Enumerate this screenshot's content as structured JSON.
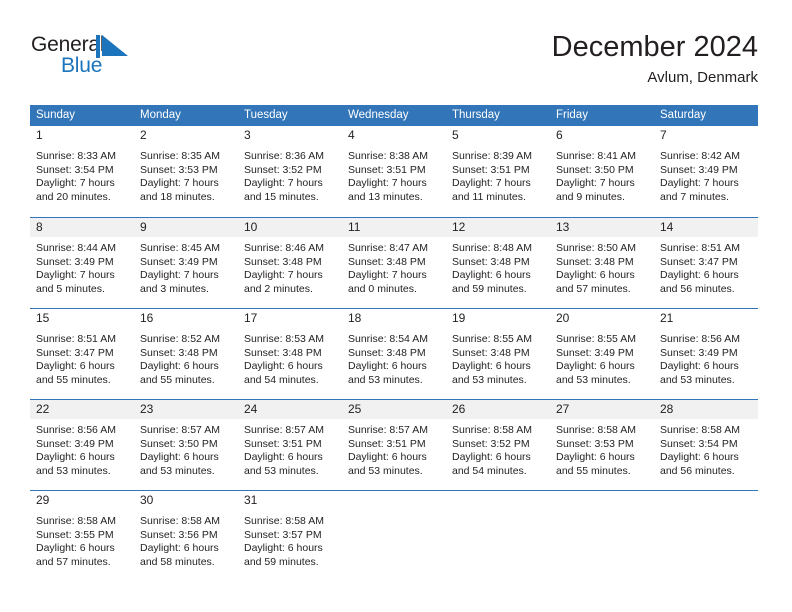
{
  "brand": {
    "name_part1": "General",
    "name_part2": "Blue",
    "mark_icon": "blue-flag-triangle-icon"
  },
  "header": {
    "title": "December 2024",
    "subtitle": "Avlum, Denmark"
  },
  "colors": {
    "header_blue": "#3275B8",
    "brand_blue": "#1C75BC",
    "row_shade": "#F1F1F1",
    "text": "#231F20"
  },
  "weekdays": [
    "Sunday",
    "Monday",
    "Tuesday",
    "Wednesday",
    "Thursday",
    "Friday",
    "Saturday"
  ],
  "weeks": [
    {
      "shaded": false,
      "days": [
        {
          "num": "1",
          "sunrise": "Sunrise: 8:33 AM",
          "sunset": "Sunset: 3:54 PM",
          "daylight1": "Daylight: 7 hours",
          "daylight2": "and 20 minutes."
        },
        {
          "num": "2",
          "sunrise": "Sunrise: 8:35 AM",
          "sunset": "Sunset: 3:53 PM",
          "daylight1": "Daylight: 7 hours",
          "daylight2": "and 18 minutes."
        },
        {
          "num": "3",
          "sunrise": "Sunrise: 8:36 AM",
          "sunset": "Sunset: 3:52 PM",
          "daylight1": "Daylight: 7 hours",
          "daylight2": "and 15 minutes."
        },
        {
          "num": "4",
          "sunrise": "Sunrise: 8:38 AM",
          "sunset": "Sunset: 3:51 PM",
          "daylight1": "Daylight: 7 hours",
          "daylight2": "and 13 minutes."
        },
        {
          "num": "5",
          "sunrise": "Sunrise: 8:39 AM",
          "sunset": "Sunset: 3:51 PM",
          "daylight1": "Daylight: 7 hours",
          "daylight2": "and 11 minutes."
        },
        {
          "num": "6",
          "sunrise": "Sunrise: 8:41 AM",
          "sunset": "Sunset: 3:50 PM",
          "daylight1": "Daylight: 7 hours",
          "daylight2": "and 9 minutes."
        },
        {
          "num": "7",
          "sunrise": "Sunrise: 8:42 AM",
          "sunset": "Sunset: 3:49 PM",
          "daylight1": "Daylight: 7 hours",
          "daylight2": "and 7 minutes."
        }
      ]
    },
    {
      "shaded": true,
      "days": [
        {
          "num": "8",
          "sunrise": "Sunrise: 8:44 AM",
          "sunset": "Sunset: 3:49 PM",
          "daylight1": "Daylight: 7 hours",
          "daylight2": "and 5 minutes."
        },
        {
          "num": "9",
          "sunrise": "Sunrise: 8:45 AM",
          "sunset": "Sunset: 3:49 PM",
          "daylight1": "Daylight: 7 hours",
          "daylight2": "and 3 minutes."
        },
        {
          "num": "10",
          "sunrise": "Sunrise: 8:46 AM",
          "sunset": "Sunset: 3:48 PM",
          "daylight1": "Daylight: 7 hours",
          "daylight2": "and 2 minutes."
        },
        {
          "num": "11",
          "sunrise": "Sunrise: 8:47 AM",
          "sunset": "Sunset: 3:48 PM",
          "daylight1": "Daylight: 7 hours",
          "daylight2": "and 0 minutes."
        },
        {
          "num": "12",
          "sunrise": "Sunrise: 8:48 AM",
          "sunset": "Sunset: 3:48 PM",
          "daylight1": "Daylight: 6 hours",
          "daylight2": "and 59 minutes."
        },
        {
          "num": "13",
          "sunrise": "Sunrise: 8:50 AM",
          "sunset": "Sunset: 3:48 PM",
          "daylight1": "Daylight: 6 hours",
          "daylight2": "and 57 minutes."
        },
        {
          "num": "14",
          "sunrise": "Sunrise: 8:51 AM",
          "sunset": "Sunset: 3:47 PM",
          "daylight1": "Daylight: 6 hours",
          "daylight2": "and 56 minutes."
        }
      ]
    },
    {
      "shaded": false,
      "days": [
        {
          "num": "15",
          "sunrise": "Sunrise: 8:51 AM",
          "sunset": "Sunset: 3:47 PM",
          "daylight1": "Daylight: 6 hours",
          "daylight2": "and 55 minutes."
        },
        {
          "num": "16",
          "sunrise": "Sunrise: 8:52 AM",
          "sunset": "Sunset: 3:48 PM",
          "daylight1": "Daylight: 6 hours",
          "daylight2": "and 55 minutes."
        },
        {
          "num": "17",
          "sunrise": "Sunrise: 8:53 AM",
          "sunset": "Sunset: 3:48 PM",
          "daylight1": "Daylight: 6 hours",
          "daylight2": "and 54 minutes."
        },
        {
          "num": "18",
          "sunrise": "Sunrise: 8:54 AM",
          "sunset": "Sunset: 3:48 PM",
          "daylight1": "Daylight: 6 hours",
          "daylight2": "and 53 minutes."
        },
        {
          "num": "19",
          "sunrise": "Sunrise: 8:55 AM",
          "sunset": "Sunset: 3:48 PM",
          "daylight1": "Daylight: 6 hours",
          "daylight2": "and 53 minutes."
        },
        {
          "num": "20",
          "sunrise": "Sunrise: 8:55 AM",
          "sunset": "Sunset: 3:49 PM",
          "daylight1": "Daylight: 6 hours",
          "daylight2": "and 53 minutes."
        },
        {
          "num": "21",
          "sunrise": "Sunrise: 8:56 AM",
          "sunset": "Sunset: 3:49 PM",
          "daylight1": "Daylight: 6 hours",
          "daylight2": "and 53 minutes."
        }
      ]
    },
    {
      "shaded": true,
      "days": [
        {
          "num": "22",
          "sunrise": "Sunrise: 8:56 AM",
          "sunset": "Sunset: 3:49 PM",
          "daylight1": "Daylight: 6 hours",
          "daylight2": "and 53 minutes."
        },
        {
          "num": "23",
          "sunrise": "Sunrise: 8:57 AM",
          "sunset": "Sunset: 3:50 PM",
          "daylight1": "Daylight: 6 hours",
          "daylight2": "and 53 minutes."
        },
        {
          "num": "24",
          "sunrise": "Sunrise: 8:57 AM",
          "sunset": "Sunset: 3:51 PM",
          "daylight1": "Daylight: 6 hours",
          "daylight2": "and 53 minutes."
        },
        {
          "num": "25",
          "sunrise": "Sunrise: 8:57 AM",
          "sunset": "Sunset: 3:51 PM",
          "daylight1": "Daylight: 6 hours",
          "daylight2": "and 53 minutes."
        },
        {
          "num": "26",
          "sunrise": "Sunrise: 8:58 AM",
          "sunset": "Sunset: 3:52 PM",
          "daylight1": "Daylight: 6 hours",
          "daylight2": "and 54 minutes."
        },
        {
          "num": "27",
          "sunrise": "Sunrise: 8:58 AM",
          "sunset": "Sunset: 3:53 PM",
          "daylight1": "Daylight: 6 hours",
          "daylight2": "and 55 minutes."
        },
        {
          "num": "28",
          "sunrise": "Sunrise: 8:58 AM",
          "sunset": "Sunset: 3:54 PM",
          "daylight1": "Daylight: 6 hours",
          "daylight2": "and 56 minutes."
        }
      ]
    },
    {
      "shaded": false,
      "days": [
        {
          "num": "29",
          "sunrise": "Sunrise: 8:58 AM",
          "sunset": "Sunset: 3:55 PM",
          "daylight1": "Daylight: 6 hours",
          "daylight2": "and 57 minutes."
        },
        {
          "num": "30",
          "sunrise": "Sunrise: 8:58 AM",
          "sunset": "Sunset: 3:56 PM",
          "daylight1": "Daylight: 6 hours",
          "daylight2": "and 58 minutes."
        },
        {
          "num": "31",
          "sunrise": "Sunrise: 8:58 AM",
          "sunset": "Sunset: 3:57 PM",
          "daylight1": "Daylight: 6 hours",
          "daylight2": "and 59 minutes."
        },
        {
          "num": "",
          "sunrise": "",
          "sunset": "",
          "daylight1": "",
          "daylight2": ""
        },
        {
          "num": "",
          "sunrise": "",
          "sunset": "",
          "daylight1": "",
          "daylight2": ""
        },
        {
          "num": "",
          "sunrise": "",
          "sunset": "",
          "daylight1": "",
          "daylight2": ""
        },
        {
          "num": "",
          "sunrise": "",
          "sunset": "",
          "daylight1": "",
          "daylight2": ""
        }
      ]
    }
  ]
}
